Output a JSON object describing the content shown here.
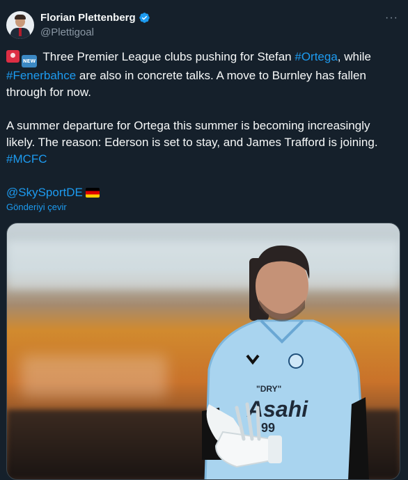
{
  "author": {
    "name": "Florian Plettenberg",
    "handle": "@Plettigoal",
    "verified": true,
    "avatar_icon": "profile-photo"
  },
  "more_icon": "more-options-icon",
  "more_label": "···",
  "tweet": {
    "line1_text": " Three Premier League clubs pushing for Stefan ",
    "hashtag_ortega": "#Ortega",
    "line1_after": ", while",
    "hashtag_fenerbahce": "#Fenerbahce",
    "line2_after": " are also in concrete talks. A move to Burnley has fallen through for now.",
    "paragraph2": "A summer departure for Ortega this summer is becoming increasingly likely. The reason: Ederson is set to stay, and James Trafford is joining.",
    "hashtag_mcfc": "#MCFC",
    "mention": "@SkySportDE",
    "emoji_new_label": "NEW"
  },
  "translate_label": "Gönderiyi çevir",
  "media": {
    "shirt_text_1": "\"DRY\"",
    "shirt_text_2": "Asahi",
    "shirt_number": "99"
  },
  "colors": {
    "background": "#15202b",
    "link": "#1d9bf0",
    "muted": "#8b98a5",
    "verified": "#1d9bf0"
  }
}
